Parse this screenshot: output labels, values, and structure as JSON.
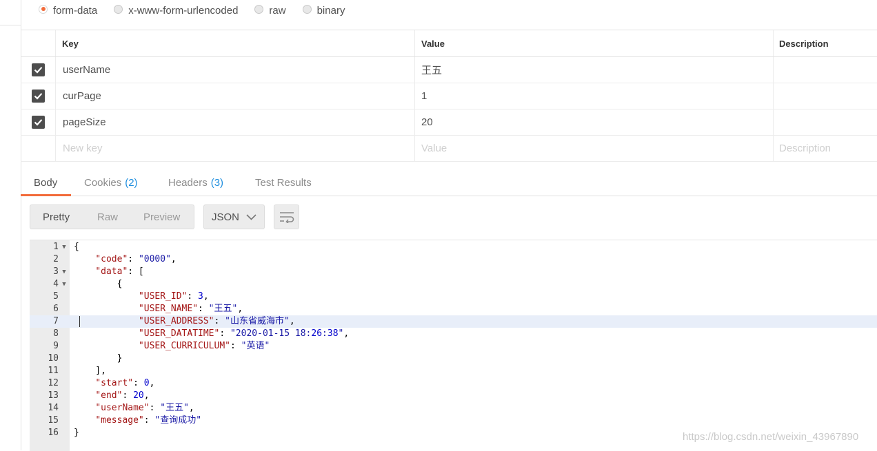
{
  "body_types": [
    {
      "label": "form-data",
      "selected": true
    },
    {
      "label": "x-www-form-urlencoded",
      "selected": false
    },
    {
      "label": "raw",
      "selected": false
    },
    {
      "label": "binary",
      "selected": false
    }
  ],
  "params": {
    "headers": {
      "key": "Key",
      "value": "Value",
      "description": "Description"
    },
    "rows": [
      {
        "checked": true,
        "key": "userName",
        "value": "王五",
        "description": ""
      },
      {
        "checked": true,
        "key": "curPage",
        "value": "1",
        "description": ""
      },
      {
        "checked": true,
        "key": "pageSize",
        "value": "20",
        "description": ""
      }
    ],
    "new_row": {
      "key_placeholder": "New key",
      "value_placeholder": "Value",
      "description_placeholder": "Description"
    }
  },
  "response_tabs": [
    {
      "label": "Body",
      "count": "",
      "active": true
    },
    {
      "label": "Cookies",
      "count": "(2)",
      "active": false
    },
    {
      "label": "Headers",
      "count": "(3)",
      "active": false
    },
    {
      "label": "Test Results",
      "count": "",
      "active": false
    }
  ],
  "view_modes": [
    "Pretty",
    "Raw",
    "Preview"
  ],
  "active_view": "Pretty",
  "format": "JSON",
  "wrap_icon": "wrap-lines-icon",
  "editor": {
    "highlighted_line": 7,
    "lines": [
      {
        "n": "1",
        "fold": true
      },
      {
        "n": "2",
        "fold": false
      },
      {
        "n": "3",
        "fold": true
      },
      {
        "n": "4",
        "fold": true
      },
      {
        "n": "5",
        "fold": false
      },
      {
        "n": "6",
        "fold": false
      },
      {
        "n": "7",
        "fold": false
      },
      {
        "n": "8",
        "fold": false
      },
      {
        "n": "9",
        "fold": false
      },
      {
        "n": "10",
        "fold": false
      },
      {
        "n": "11",
        "fold": false
      },
      {
        "n": "12",
        "fold": false
      },
      {
        "n": "13",
        "fold": false
      },
      {
        "n": "14",
        "fold": false
      },
      {
        "n": "15",
        "fold": false
      },
      {
        "n": "16",
        "fold": false
      }
    ],
    "json_text": [
      "{",
      "    \"code\": \"0000\",",
      "    \"data\": [",
      "        {",
      "            \"USER_ID\": 3,",
      "            \"USER_NAME\": \"王五\",",
      "            \"USER_ADDRESS\": \"山东省威海市\",",
      "            \"USER_DATATIME\": \"2020-01-15 18:26:38\",",
      "            \"USER_CURRICULUM\": \"英语\"",
      "        }",
      "    ],",
      "    \"start\": 0,",
      "    \"end\": 20,",
      "    \"userName\": \"王五\",",
      "    \"message\": \"查询成功\"",
      "}"
    ]
  },
  "watermark": "https://blog.csdn.net/weixin_43967890"
}
